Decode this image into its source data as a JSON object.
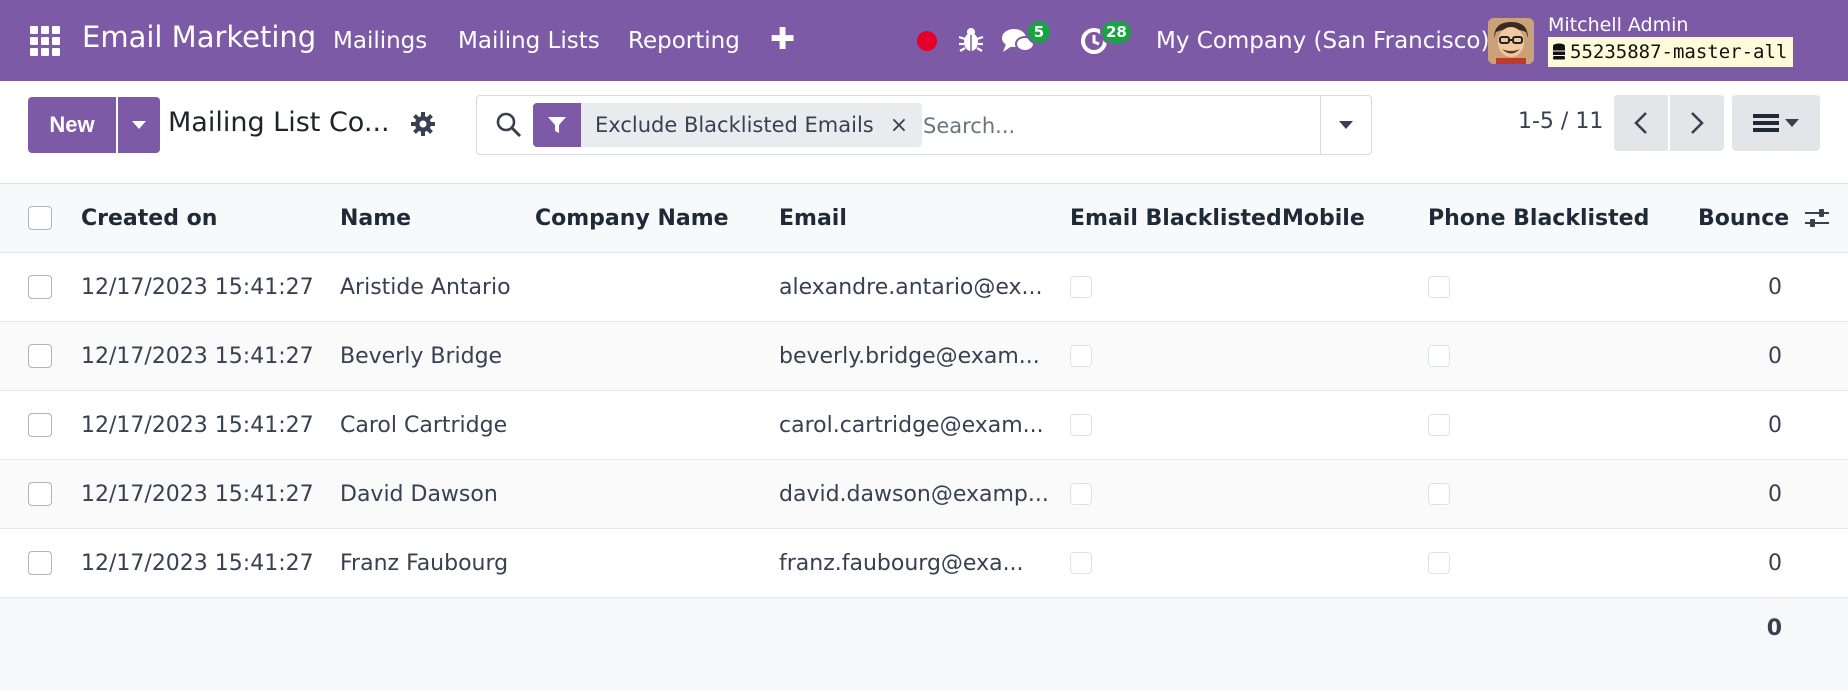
{
  "navbar": {
    "app_title": "Email Marketing",
    "menu": [
      "Mailings",
      "Mailing Lists",
      "Reporting"
    ],
    "chat_count": "5",
    "activity_count": "28",
    "company": "My Company (San Francisco)",
    "user_name": "Mitchell Admin",
    "database": "55235887-master-all",
    "accent_color": "#7c5aa6",
    "badge_color": "#18a345"
  },
  "control_panel": {
    "new_label": "New",
    "title": "Mailing List Co...",
    "facet_label": "Exclude Blacklisted Emails",
    "facet_remove": "×",
    "search_placeholder": "Search...",
    "pager": "1-5 / 11"
  },
  "table": {
    "columns": [
      "Created on",
      "Name",
      "Company Name",
      "Email",
      "Email Blacklisted",
      "Mobile",
      "Phone Blacklisted",
      "Bounce"
    ],
    "rows": [
      {
        "created": "12/17/2023 15:41:27",
        "name": "Aristide Antario",
        "company": "",
        "email": "alexandre.antario@ex...",
        "mobile": "",
        "bounce": "0"
      },
      {
        "created": "12/17/2023 15:41:27",
        "name": "Beverly Bridge",
        "company": "",
        "email": "beverly.bridge@exam...",
        "mobile": "",
        "bounce": "0"
      },
      {
        "created": "12/17/2023 15:41:27",
        "name": "Carol Cartridge",
        "company": "",
        "email": "carol.cartridge@exam...",
        "mobile": "",
        "bounce": "0"
      },
      {
        "created": "12/17/2023 15:41:27",
        "name": "David Dawson",
        "company": "",
        "email": "david.dawson@examp...",
        "mobile": "",
        "bounce": "0"
      },
      {
        "created": "12/17/2023 15:41:27",
        "name": "Franz Faubourg",
        "company": "",
        "email": "franz.faubourg@exa...",
        "mobile": "",
        "bounce": "0"
      }
    ],
    "bounce_total": "0"
  }
}
